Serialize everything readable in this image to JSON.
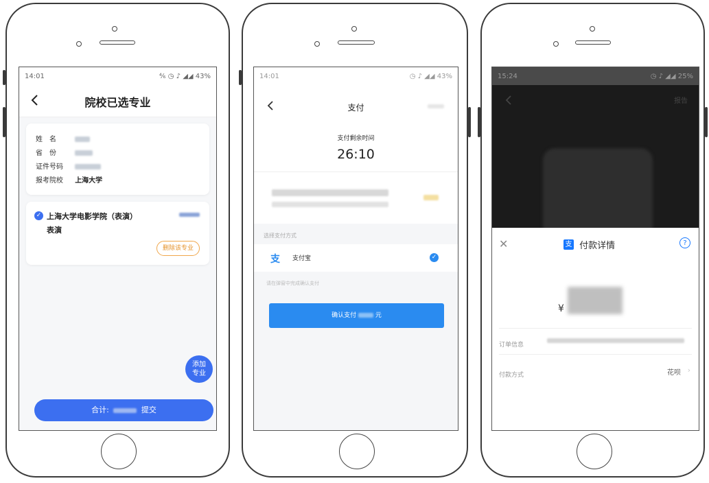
{
  "phone1": {
    "status_time": "14:01",
    "status_icons": "⁴⁄₆ ◷ ♪ ◢◢",
    "status_battery": "43%",
    "back_icon": "back-arrow",
    "title": "院校已选专业",
    "info": {
      "name_label": "姓　名",
      "province_label": "省　份",
      "id_label": "证件号码",
      "school_label": "报考院校",
      "school_value": "上海大学"
    },
    "major": {
      "name": "上海大学电影学院（表演）",
      "sub": "表演",
      "delete_label": "删除该专业"
    },
    "fab_label": "添加\n专业",
    "fab_line1": "添加",
    "fab_line2": "专业",
    "total_prefix": "合计:",
    "submit_label": "提交",
    "accent": "#3c6ff0"
  },
  "phone2": {
    "status_time": "14:01",
    "status_icons": "◷ ♪ ◢◢",
    "status_battery": "43%",
    "title": "支付",
    "remaining_label": "支付剩余时间",
    "countdown": "26:10",
    "method_header": "选择支付方式",
    "method_name": "支付宝",
    "hint": "请在弹窗中完成确认支付",
    "confirm_prefix": "确认支付",
    "confirm_suffix": "元",
    "accent": "#2a8bf0"
  },
  "phone3": {
    "status_time": "15:24",
    "status_icons": "◷ ♪ ◢◢",
    "status_battery": "25%",
    "report_label": "报告",
    "sheet_title": "付款详情",
    "currency": "¥",
    "order_label": "订单信息",
    "method_label": "付款方式",
    "method_value": "花呗",
    "accent": "#1677ff"
  }
}
